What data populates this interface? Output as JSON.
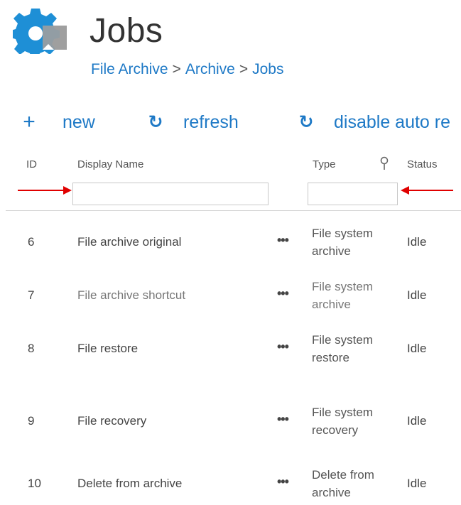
{
  "header": {
    "title": "Jobs",
    "breadcrumb": [
      "File Archive",
      "Archive",
      "Jobs"
    ],
    "breadcrumb_separator": ">"
  },
  "toolbar": {
    "new_label": "new",
    "new_icon": "+",
    "refresh_label": "refresh",
    "refresh_icon": "↻",
    "disable_label": "disable auto re",
    "disable_icon": "↻"
  },
  "table": {
    "columns": {
      "id": "ID",
      "name": "Display Name",
      "type": "Type",
      "status": "Status"
    },
    "filters": {
      "name_value": "",
      "type_value": ""
    },
    "menu_glyph": "•••",
    "rows": [
      {
        "id": "6",
        "name": "File archive original",
        "type_line1": "File system",
        "type_line2": "archive",
        "status": "Idle"
      },
      {
        "id": "7",
        "name": "File archive shortcut",
        "type_line1": "File system",
        "type_line2": "archive",
        "status": "Idle"
      },
      {
        "id": "8",
        "name": "File restore",
        "type_line1": "File system",
        "type_line2": "restore",
        "status": "Idle"
      },
      {
        "id": "9",
        "name": "File recovery",
        "type_line1": "File system",
        "type_line2": "recovery",
        "status": "Idle"
      },
      {
        "id": "10",
        "name": "Delete from archive",
        "type_line1": "Delete from",
        "type_line2": "archive",
        "status": "Idle"
      }
    ]
  },
  "colors": {
    "accent": "#1e79c6",
    "annotation_arrow": "#e00000",
    "gear": "#1e8fd6"
  }
}
